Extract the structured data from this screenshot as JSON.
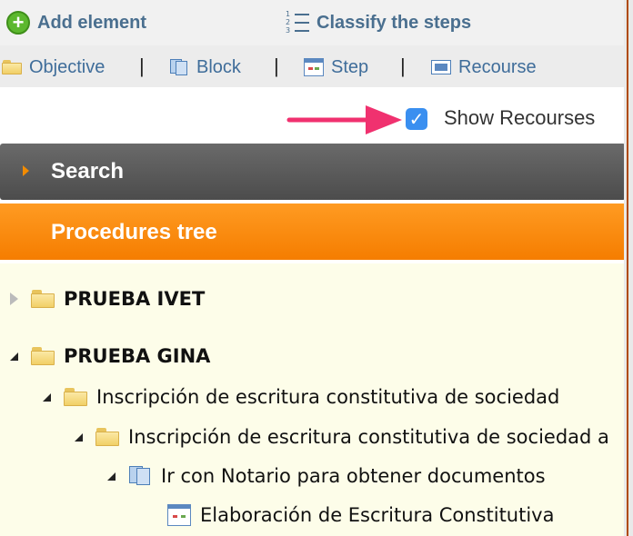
{
  "toolbar": {
    "add_element": "Add element",
    "classify_steps": "Classify the steps"
  },
  "element_types": {
    "objective": "Objective",
    "block": "Block",
    "step": "Step",
    "recourse": "Recourse",
    "separator": "|"
  },
  "show_recourses": {
    "label": "Show Recourses",
    "checked": true
  },
  "search": {
    "label": "Search"
  },
  "procedures": {
    "title": "Procedures tree",
    "nodes": [
      {
        "label": "PRUEBA IVET",
        "icon": "folder-icon",
        "expanded": false
      },
      {
        "label": "PRUEBA GINA",
        "icon": "folder-icon",
        "expanded": true
      },
      {
        "label": "Inscripción de escritura constitutiva de sociedad",
        "icon": "folder-icon",
        "expanded": true
      },
      {
        "label": "Inscripción de escritura constitutiva de sociedad a",
        "icon": "folder-icon",
        "expanded": true
      },
      {
        "label": "Ir con Notario para obtener documentos",
        "icon": "block-icon",
        "expanded": true
      },
      {
        "label": "Elaboración de Escritura Constitutiva",
        "icon": "step-icon"
      }
    ]
  },
  "colors": {
    "accent_orange": "#f57d00",
    "link_blue": "#3f6d9a",
    "checkbox_blue": "#3a8ff0",
    "arrow_pink": "#f0316f"
  }
}
